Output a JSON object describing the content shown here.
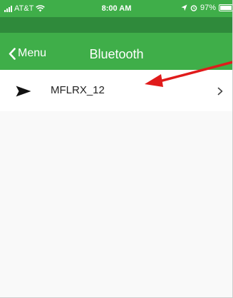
{
  "status_bar": {
    "carrier": "AT&T",
    "time": "8:00 AM",
    "battery": "97%",
    "battery_level": 0.97
  },
  "nav": {
    "back_label": "Menu",
    "title": "Bluetooth"
  },
  "devices": [
    {
      "name": "MFLRX_12",
      "icon": "paper-plane-icon"
    }
  ],
  "colors": {
    "header_green": "#3fae49",
    "band_green": "#2f8a3b",
    "annotation_arrow": "#e01b1b"
  }
}
